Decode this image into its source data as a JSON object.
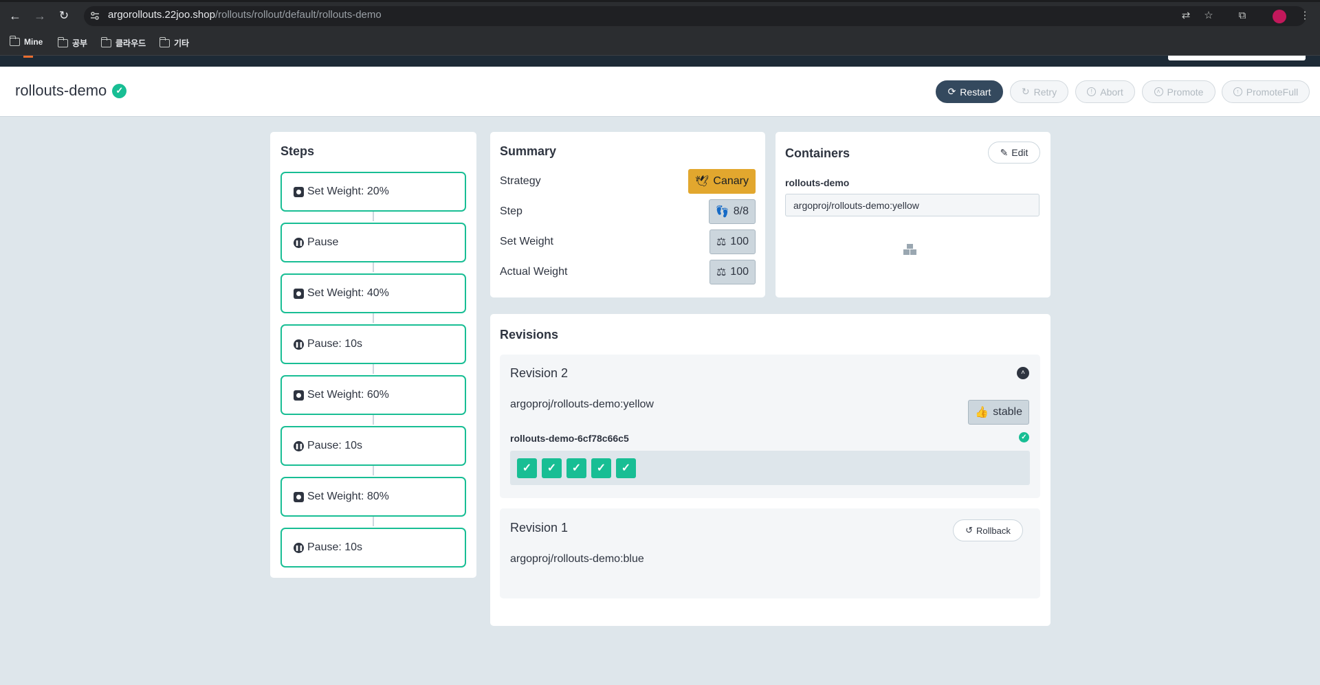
{
  "browser": {
    "url_host": "argorollouts.22joo.shop",
    "url_path": "/rollouts/rollout/default/rollouts-demo",
    "bookmarks": [
      "Mine",
      "공부",
      "클라우드",
      "기타"
    ]
  },
  "header": {
    "title": "rollouts-demo",
    "buttons": {
      "restart": "Restart",
      "retry": "Retry",
      "abort": "Abort",
      "promote": "Promote",
      "promote_full": "PromoteFull"
    }
  },
  "steps": {
    "title": "Steps",
    "items": [
      {
        "label": "Set Weight: 20%",
        "icon": "weight-icon"
      },
      {
        "label": "Pause",
        "icon": "pause-icon"
      },
      {
        "label": "Set Weight: 40%",
        "icon": "weight-icon"
      },
      {
        "label": "Pause: 10s",
        "icon": "pause-icon"
      },
      {
        "label": "Set Weight: 60%",
        "icon": "weight-icon"
      },
      {
        "label": "Pause: 10s",
        "icon": "pause-icon"
      },
      {
        "label": "Set Weight: 80%",
        "icon": "weight-icon"
      },
      {
        "label": "Pause: 10s",
        "icon": "pause-icon"
      }
    ]
  },
  "summary": {
    "title": "Summary",
    "strategy_label": "Strategy",
    "strategy_value": "Canary",
    "step_label": "Step",
    "step_value": "8/8",
    "set_weight_label": "Set Weight",
    "set_weight_value": "100",
    "actual_weight_label": "Actual Weight",
    "actual_weight_value": "100"
  },
  "containers": {
    "title": "Containers",
    "edit_label": "Edit",
    "name": "rollouts-demo",
    "image": "argoproj/rollouts-demo:yellow"
  },
  "revisions": {
    "title": "Revisions",
    "items": [
      {
        "title": "Revision 2",
        "image": "argoproj/rollouts-demo:yellow",
        "badge": "stable",
        "replicaset": "rollouts-demo-6cf78c66c5",
        "pods_ready": 5
      },
      {
        "title": "Revision 1",
        "image": "argoproj/rollouts-demo:blue",
        "rollback_label": "Rollback"
      }
    ]
  },
  "colors": {
    "success": "#18be94",
    "canary": "#e2a72e",
    "primary_button": "#34495e",
    "page_background": "#dee6eb"
  }
}
